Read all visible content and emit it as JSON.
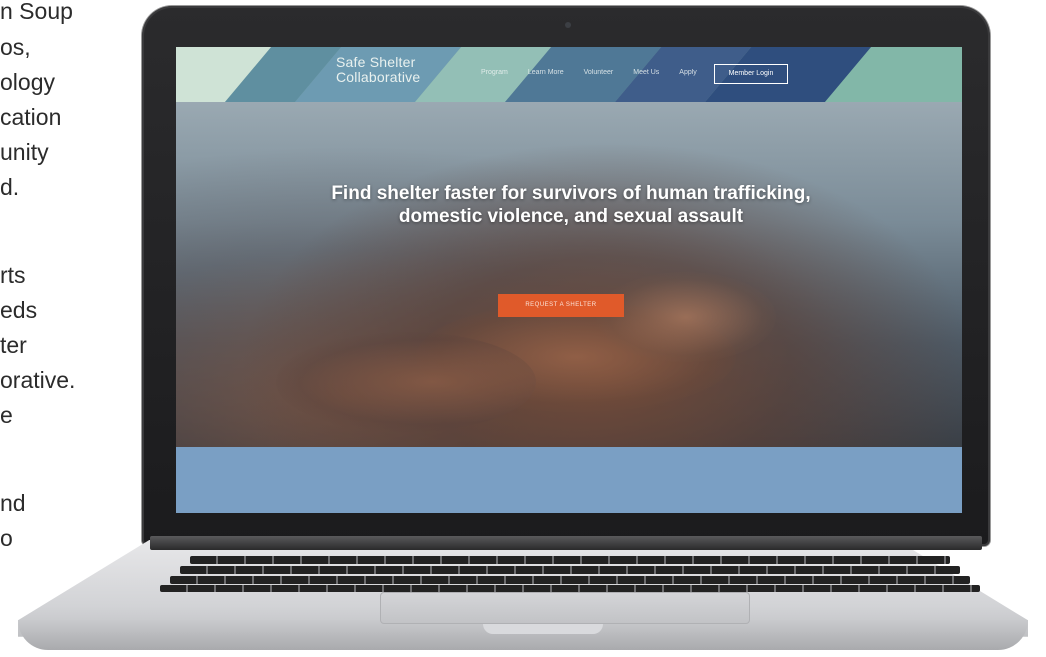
{
  "article_text": {
    "lines": [
      "n Soup",
      "os,",
      "ology",
      "cation",
      "unity",
      "d.",
      "",
      "rts",
      "eds",
      "ter",
      "orative.",
      "e",
      "",
      "nd",
      "o"
    ]
  },
  "website": {
    "logo_line1": "Safe Shelter",
    "logo_line2": "Collaborative",
    "nav": [
      "Program",
      "Learn More",
      "Volunteer",
      "Meet Us",
      "Apply"
    ],
    "login_label": "Member Login",
    "headline": "Find shelter faster for survivors of human trafficking, domestic violence, and sexual assault",
    "cta_label": "REQUEST A SHELTER",
    "colors": {
      "header": "#7fa5a0",
      "cta": "#e05a2a",
      "footer_band": "#7a9fc4"
    }
  }
}
